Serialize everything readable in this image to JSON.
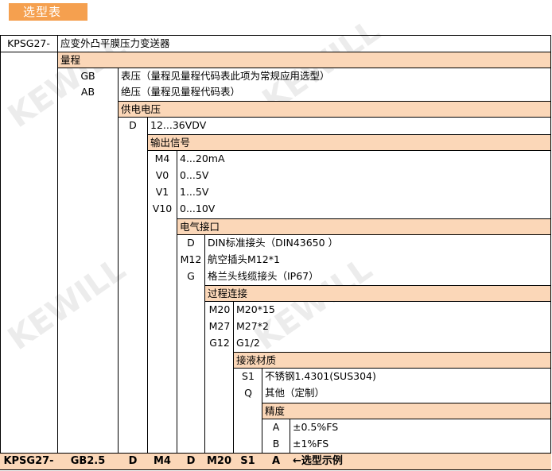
{
  "badge": "选型表",
  "model_prefix": "KPSG27-",
  "product_name": "应变外凸平膜压力变送器",
  "sections": {
    "range": {
      "title": "量程",
      "items": [
        {
          "code": "GB",
          "desc": "表压（量程见量程代码表此项为常规应用选型）"
        },
        {
          "code": "AB",
          "desc": "绝压（量程见量程代码表）"
        }
      ]
    },
    "power": {
      "title": "供电电压",
      "items": [
        {
          "code": "D",
          "desc": "12...36VDV"
        }
      ]
    },
    "output": {
      "title": "输出信号",
      "items": [
        {
          "code": "M4",
          "desc": "4...20mA"
        },
        {
          "code": "V0",
          "desc": "0...5V"
        },
        {
          "code": "V1",
          "desc": "1...5V"
        },
        {
          "code": "V10",
          "desc": "0...10V"
        }
      ]
    },
    "electrical": {
      "title": "电气接口",
      "items": [
        {
          "code": "D",
          "desc": "DIN标准接头（DIN43650 ）"
        },
        {
          "code": "M12",
          "desc": "航空插头M12*1"
        },
        {
          "code": "G",
          "desc": "格兰头线缆接头（IP67）"
        }
      ]
    },
    "process": {
      "title": "过程连接",
      "items": [
        {
          "code": "M20",
          "desc": "M20*15"
        },
        {
          "code": "M27",
          "desc": "M27*2"
        },
        {
          "code": "G12",
          "desc": "G1/2"
        }
      ]
    },
    "material": {
      "title": "接液材质",
      "items": [
        {
          "code": "S1",
          "desc": "不锈钢1.4301(SUS304)"
        },
        {
          "code": "Q",
          "desc": "其他（定制）"
        }
      ]
    },
    "accuracy": {
      "title": "精度",
      "items": [
        {
          "code": "A",
          "desc": "±0.5%FS"
        },
        {
          "code": "B",
          "desc": "±1%FS"
        }
      ]
    }
  },
  "example": {
    "codes": [
      "KPSG27-",
      "GB2.5",
      "D",
      "M4",
      "D",
      "M20",
      "S1",
      "A"
    ],
    "label": "←选型示例"
  },
  "colors": {
    "badge": "#f5a04f",
    "header_fill": "#fbd7b8"
  }
}
